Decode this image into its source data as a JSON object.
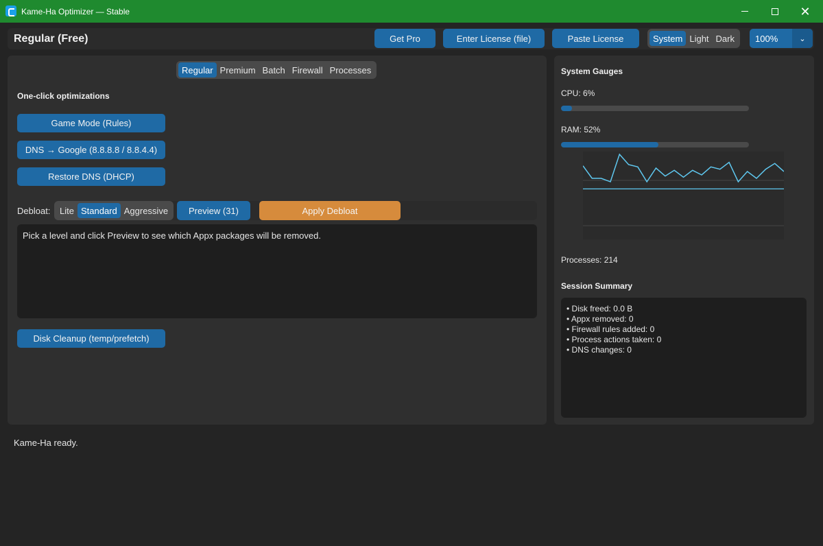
{
  "window": {
    "title": "Kame-Ha Optimizer — Stable"
  },
  "header": {
    "tier": "Regular (Free)",
    "get_pro": "Get Pro",
    "enter_license": "Enter License (file)",
    "paste_license": "Paste License",
    "theme": [
      "System",
      "Light",
      "Dark"
    ],
    "theme_selected": "System",
    "zoom": "100%"
  },
  "tabs": [
    "Regular",
    "Premium",
    "Batch",
    "Firewall",
    "Processes"
  ],
  "tab_selected": "Regular",
  "regular": {
    "section_title": "One-click optimizations",
    "game_mode": "Game Mode (Rules)",
    "dns_google": "DNS → Google (8.8.8.8 / 8.8.4.4)",
    "restore_dns": "Restore DNS (DHCP)",
    "debloat_label": "Debloat:",
    "debloat_levels": [
      "Lite",
      "Standard",
      "Aggressive"
    ],
    "debloat_selected": "Standard",
    "preview": "Preview (31)",
    "apply_debloat": "Apply Debloat",
    "output_text": "Pick a level and click Preview to see which Appx packages will be removed.",
    "disk_cleanup": "Disk Cleanup (temp/prefetch)"
  },
  "gauges": {
    "title": "System Gauges",
    "cpu_label": "CPU: 6%",
    "cpu_value": 0.06,
    "ram_label": "RAM: 52%",
    "ram_value": 0.52,
    "processes_label": "Processes: 214",
    "series_a": [
      14,
      3,
      3,
      0,
      24,
      15,
      13,
      0,
      12,
      5,
      10,
      4,
      10,
      6,
      13,
      11,
      17,
      0,
      9,
      3,
      11,
      16,
      9
    ],
    "series_b_level": 0.45,
    "accent_color": "#5fc8f0"
  },
  "summary": {
    "title": "Session Summary",
    "lines": [
      "• Disk freed: 0.0 B",
      "• Appx removed: 0",
      "• Firewall rules added: 0",
      "• Process actions taken: 0",
      "• DNS changes: 0"
    ]
  },
  "status": "Kame-Ha ready."
}
